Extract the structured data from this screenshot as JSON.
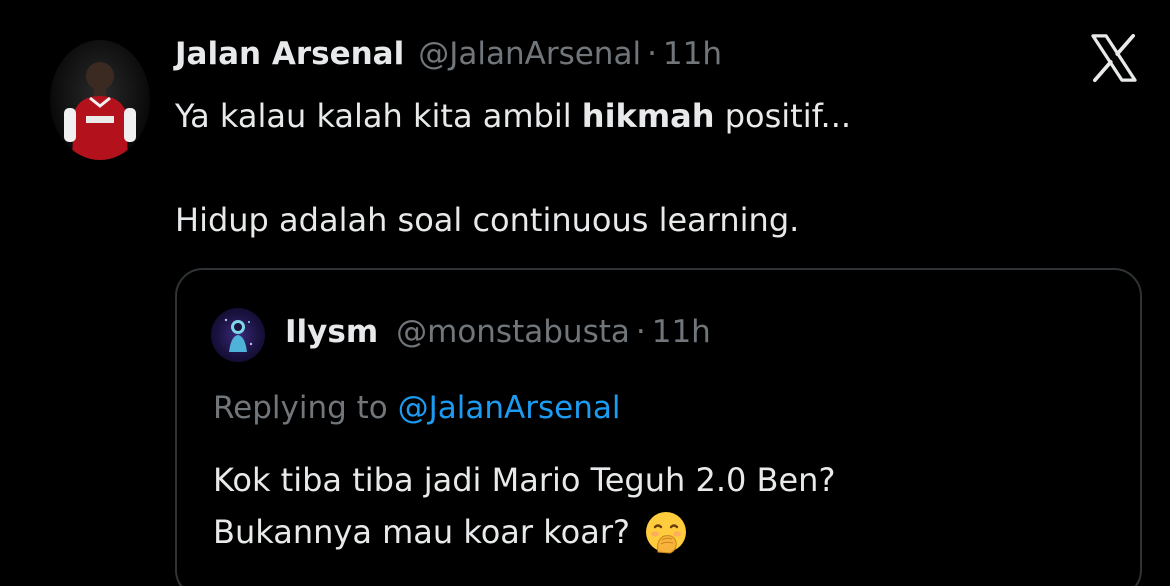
{
  "tweet": {
    "author_name": "Jalan Arsenal",
    "author_handle": "@JalanArsenal",
    "separator": "·",
    "time": "11h",
    "lines": {
      "line1_before": "Ya kalau kalah kita ambil ",
      "line1_bold": "hikmah",
      "line1_after": " positif...",
      "line2": "Hidup adalah soal continuous learning."
    }
  },
  "quote": {
    "author_name": "Ilysm",
    "author_handle": "@monstabusta",
    "separator": "·",
    "time": "11h",
    "replying_prefix": "Replying to ",
    "replying_handle": "@JalanArsenal",
    "line1": "Kok tiba tiba jadi Mario Teguh 2.0 Ben?",
    "line2": "Bukannya mau koar koar?"
  },
  "icons": {
    "brand": "x-logo-icon",
    "avatar": "profile-avatar",
    "quote_avatar": "quote-profile-avatar",
    "emoji": "face-with-hand-over-mouth-emoji"
  },
  "colors": {
    "background": "#000000",
    "text_primary": "#e7e9ea",
    "text_secondary": "#71767b",
    "link": "#1d9bf0",
    "border": "#2f3336"
  }
}
